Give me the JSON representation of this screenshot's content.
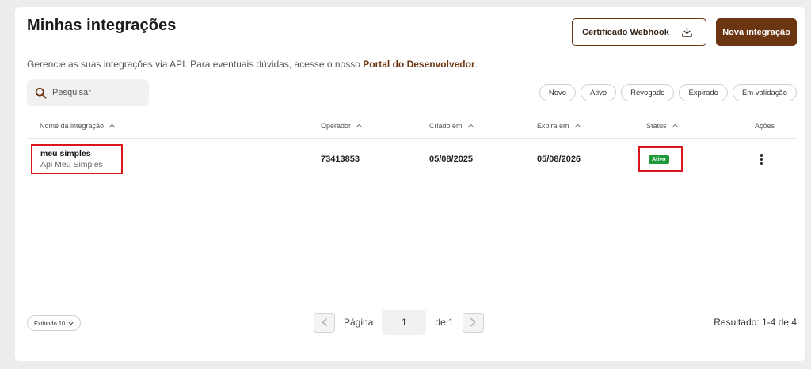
{
  "header": {
    "title": "Minhas integrações",
    "webhook_label": "Certificado Webhook",
    "new_label": "Nova integração"
  },
  "subtitle": {
    "text": "Gerencie as suas integrações via API. Para eventuais dúvidas, acesse o nosso ",
    "link": "Portal do Desenvolvedor",
    "suffix": "."
  },
  "search": {
    "placeholder": "Pesquisar"
  },
  "filters": [
    "Novo",
    "Ativo",
    "Revogado",
    "Expirado",
    "Em validação"
  ],
  "table": {
    "columns": [
      "Nome da integração",
      "Operador",
      "Criado em",
      "Expira em",
      "Status",
      "Ações"
    ],
    "rows": [
      {
        "name": "meu simples",
        "description": "Api Meu Simples",
        "operator": "73413853",
        "created": "05/08/2025",
        "expires": "05/08/2026",
        "status": "Ativo"
      }
    ]
  },
  "footer": {
    "page_size": "Exibindo 10",
    "page_label": "Página",
    "page_value": "1",
    "page_total": "de 1",
    "result": "Resultado: 1-4 de 4"
  },
  "colors": {
    "brand": "#6b3512",
    "status_active": "#1f9a3b",
    "highlight": "#d9151d"
  }
}
